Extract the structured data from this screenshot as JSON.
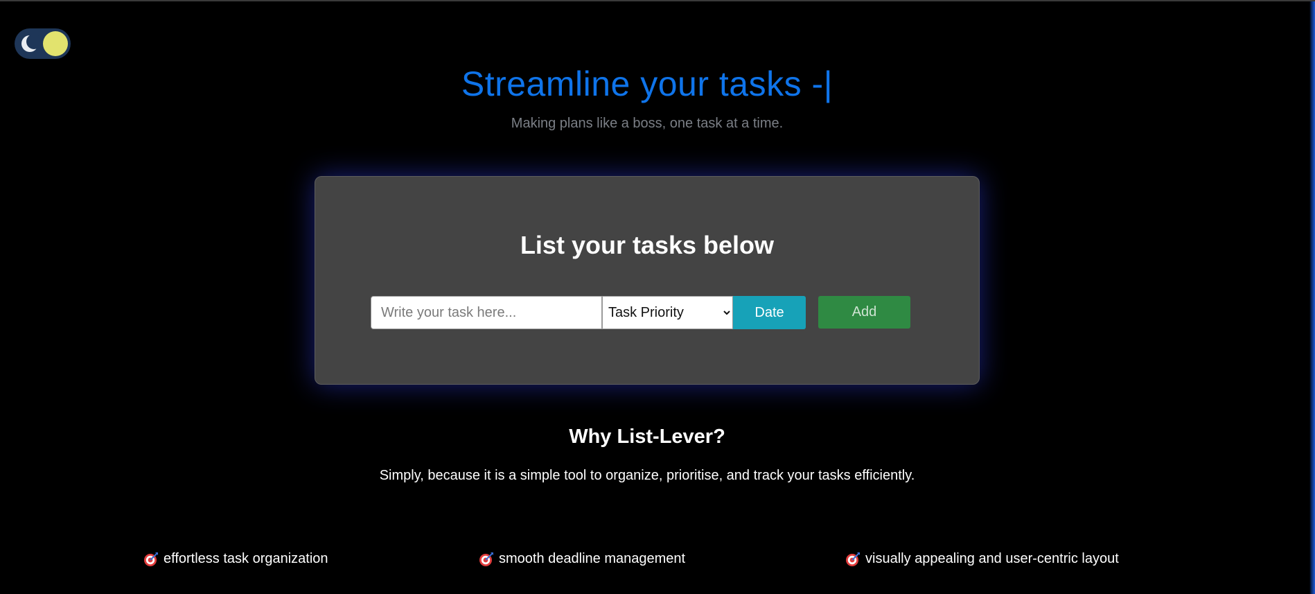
{
  "theme_toggle": {
    "state": "dark",
    "moon_icon": "moon-icon",
    "knob_color": "#e2e36e"
  },
  "header": {
    "title": "Streamline your tasks -|",
    "subtitle": "Making plans like a boss, one task at a time."
  },
  "task_card": {
    "title": "List your tasks below",
    "task_input": {
      "value": "",
      "placeholder": "Write your task here..."
    },
    "priority_select": {
      "selected": "Task Priority"
    },
    "date_label": "Date",
    "add_label": "Add"
  },
  "why": {
    "title": "Why List-Lever?",
    "text": "Simply, because it is a simple tool to organize, prioritise, and track your tasks efficiently."
  },
  "features": [
    {
      "icon": "target-icon",
      "label": "effortless task organization"
    },
    {
      "icon": "target-icon",
      "label": "smooth deadline management"
    },
    {
      "icon": "target-icon",
      "label": "visually appealing and user-centric layout"
    }
  ],
  "colors": {
    "background": "#000000",
    "accent_title": "#0f74ea",
    "card": "#444444",
    "date_button": "#17a2b8",
    "add_button": "#2f8a43"
  }
}
